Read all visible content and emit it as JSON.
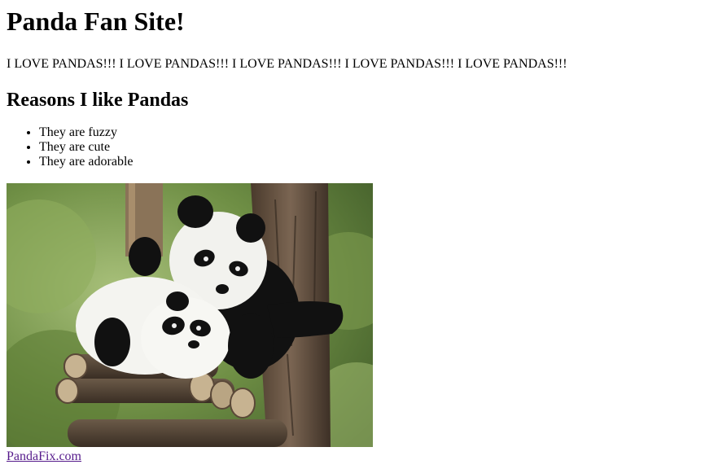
{
  "page": {
    "title": "Panda Fan Site!",
    "love_line": "I LOVE PANDAS!!! I LOVE PANDAS!!! I LOVE PANDAS!!! I LOVE PANDAS!!! I LOVE PANDAS!!!",
    "reasons_heading": "Reasons I like Pandas",
    "reasons": [
      "They are fuzzy",
      "They are cute",
      "They are adorable"
    ],
    "image_alt": "Two pandas hugging on a tree",
    "link_text": "PandaFix.com",
    "link_color": "#551a8b"
  }
}
